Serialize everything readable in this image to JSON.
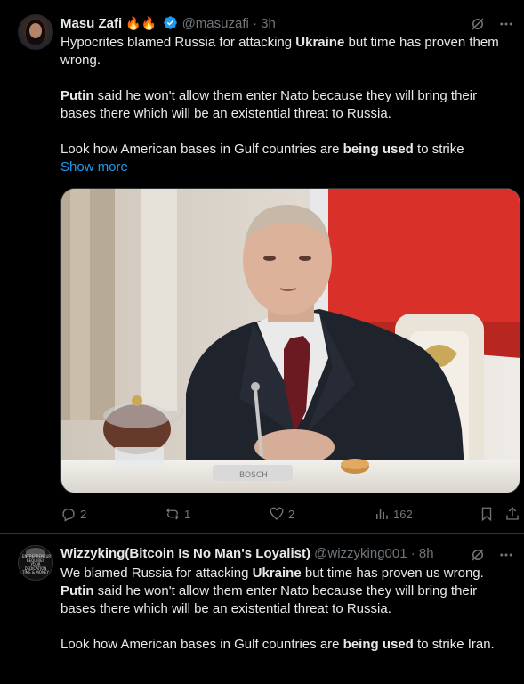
{
  "tweets": [
    {
      "display_name": "Masu Zafi",
      "name_emoji": "🔥🔥",
      "handle": "@masuzafi",
      "separator": "·",
      "time": "3h",
      "body": [
        [
          {
            "t": "Hypocrites blamed Russia for attacking "
          },
          {
            "t": "Ukraine",
            "b": true
          },
          {
            "t": " but time has proven them wrong."
          }
        ],
        [
          {
            "t": "Putin",
            "b": true
          },
          {
            "t": " said he won't allow them enter Nato because they will bring their bases there which will be an existential threat to Russia."
          }
        ],
        [
          {
            "t": "Look how American bases in Gulf countries are "
          },
          {
            "t": "being used",
            "b": true
          },
          {
            "t": " to strike"
          }
        ]
      ],
      "show_more": "Show more",
      "media_alt": "Vladimir Putin seated at a table with microphone and tea set",
      "microphone_brand": "BOSCH",
      "stats": {
        "replies": "2",
        "reposts": "1",
        "likes": "2",
        "views": "162"
      }
    },
    {
      "display_name": "Wizzyking(Bitcoin Is No Man's Loyalist)",
      "handle": "@wizzyking001",
      "separator": "·",
      "time": "8h",
      "body": [
        [
          {
            "t": "We blamed Russia for attacking "
          },
          {
            "t": "Ukraine",
            "b": true
          },
          {
            "t": " but time has proven us wrong."
          },
          {
            "br": true
          },
          {
            "t": "Putin",
            "b": true
          },
          {
            "t": " said he won't allow them enter Nato because they will bring their bases there which will be an existential threat to Russia."
          }
        ],
        [
          {
            "t": "Look how American bases in Gulf countries are "
          },
          {
            "t": "being used",
            "b": true
          },
          {
            "t": " to strike Iran."
          }
        ]
      ],
      "avatar_text": "ENTREPRENEURSHIP REQUIRES YOUR DEDICATION TIME & MONEY"
    }
  ],
  "icons": {
    "grok": "grok-icon",
    "more": "more-dots-icon",
    "reply": "reply-icon",
    "repost": "repost-icon",
    "like": "like-icon",
    "views": "views-icon",
    "bookmark": "bookmark-icon",
    "share": "share-icon",
    "verified": "verified-badge-icon"
  },
  "colors": {
    "link": "#1d9bf0",
    "verified": "#1d9bf0",
    "muted": "#71767b",
    "text": "#e7e9ea",
    "background": "#000000"
  }
}
